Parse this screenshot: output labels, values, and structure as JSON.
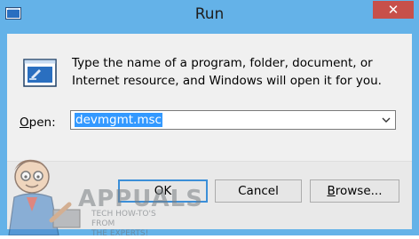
{
  "window": {
    "title": "Run",
    "close_glyph": "✕"
  },
  "dialog": {
    "description": "Type the name of a program, folder, document, or Internet resource, and Windows will open it for you.",
    "open_label_prefix": "",
    "open_label_accel": "O",
    "open_label_rest": "pen:",
    "open_value": "devmgmt.msc"
  },
  "buttons": {
    "ok": "OK",
    "cancel": "Cancel",
    "browse_accel": "B",
    "browse_rest": "rowse..."
  },
  "watermark": {
    "title": "APPUALS",
    "subtitle_line1": "TECH HOW-TO'S FROM",
    "subtitle_line2": "THE EXPERTS!"
  },
  "colors": {
    "frame": "#64b2e8",
    "close": "#c7504a",
    "selection": "#3399ff",
    "default_button_border": "#3c8fd8"
  },
  "icons": {
    "title": "run-app-icon",
    "dialog": "run-app-icon",
    "dropdown": "chevron-down-icon",
    "close": "close-icon"
  }
}
